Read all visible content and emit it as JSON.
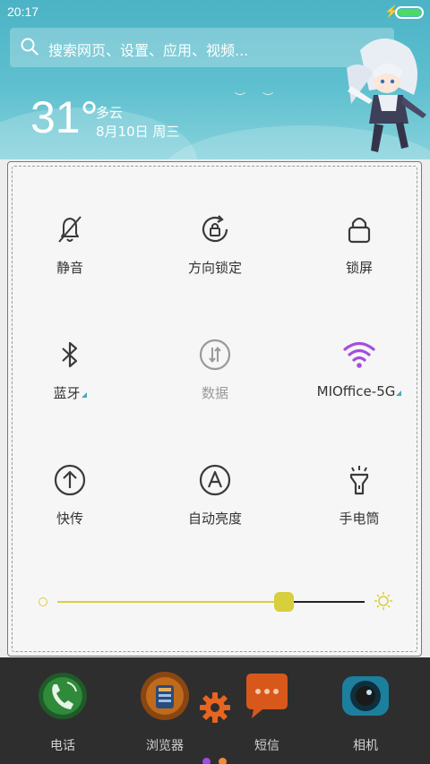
{
  "status_bar": {
    "time": "20:17",
    "battery_color": "#4cd964"
  },
  "search": {
    "placeholder": "搜索网页、设置、应用、视频..."
  },
  "weather": {
    "temperature": "31°",
    "condition": "多云",
    "date": "8月10日 周三"
  },
  "toggles": [
    {
      "label": "静音",
      "icon": "bell-off-icon",
      "state": "off"
    },
    {
      "label": "方向锁定",
      "icon": "rotation-lock-icon",
      "state": "off"
    },
    {
      "label": "锁屏",
      "icon": "lock-icon",
      "state": "off"
    },
    {
      "label": "蓝牙",
      "icon": "bluetooth-icon",
      "state": "off"
    },
    {
      "label": "数据",
      "icon": "mobile-data-icon",
      "state": "disabled"
    },
    {
      "label": "MIOffice-5G",
      "icon": "wifi-icon",
      "state": "on",
      "accent": "#a24fe0"
    },
    {
      "label": "快传",
      "icon": "upload-icon",
      "state": "off"
    },
    {
      "label": "自动亮度",
      "icon": "auto-brightness-icon",
      "state": "off"
    },
    {
      "label": "手电筒",
      "icon": "flashlight-icon",
      "state": "off"
    }
  ],
  "brightness": {
    "level": 0.68,
    "color": "#d7cf3b"
  },
  "dock": {
    "apps": [
      {
        "label": "电话",
        "icon": "phone-icon",
        "color": "#2f8a3a"
      },
      {
        "label": "浏览器",
        "icon": "browser-icon",
        "color": "#c06a1c"
      },
      {
        "label": "短信",
        "icon": "messages-icon",
        "color": "#d8581b"
      },
      {
        "label": "相机",
        "icon": "camera-icon",
        "color": "#1d7f9e"
      }
    ],
    "page_dots": [
      {
        "color": "#9b4fe0",
        "active": true
      },
      {
        "color": "#f08a3a",
        "active": false
      }
    ]
  }
}
